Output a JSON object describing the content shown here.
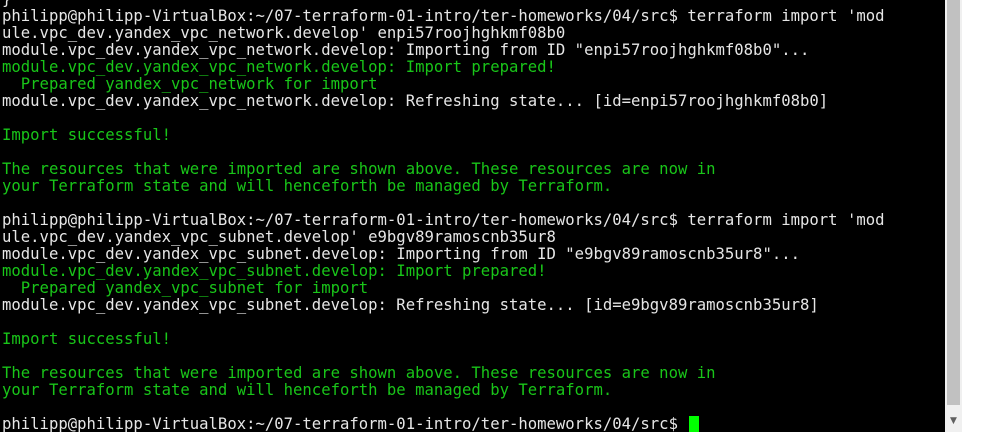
{
  "terminal": {
    "lines": [
      {
        "text": "}",
        "color": "white"
      },
      {
        "text": "philipp@philipp-VirtualBox:~/07-terraform-01-intro/ter-homeworks/04/src$ terraform import 'mod",
        "color": "white"
      },
      {
        "text": "ule.vpc_dev.yandex_vpc_network.develop' enpi57roojhghkmf08b0",
        "color": "white"
      },
      {
        "text": "module.vpc_dev.yandex_vpc_network.develop: Importing from ID \"enpi57roojhghkmf08b0\"...",
        "color": "white"
      },
      {
        "text": "module.vpc_dev.yandex_vpc_network.develop: Import prepared!",
        "color": "green"
      },
      {
        "text": "  Prepared yandex_vpc_network for import",
        "color": "green"
      },
      {
        "text": "module.vpc_dev.yandex_vpc_network.develop: Refreshing state... [id=enpi57roojhghkmf08b0]",
        "color": "white"
      },
      {
        "text": "",
        "color": "white"
      },
      {
        "text": "Import successful!",
        "color": "green"
      },
      {
        "text": "",
        "color": "white"
      },
      {
        "text": "The resources that were imported are shown above. These resources are now in",
        "color": "green"
      },
      {
        "text": "your Terraform state and will henceforth be managed by Terraform.",
        "color": "green"
      },
      {
        "text": "",
        "color": "white"
      },
      {
        "text": "philipp@philipp-VirtualBox:~/07-terraform-01-intro/ter-homeworks/04/src$ terraform import 'mod",
        "color": "white"
      },
      {
        "text": "ule.vpc_dev.yandex_vpc_subnet.develop' e9bgv89ramoscnb35ur8",
        "color": "white"
      },
      {
        "text": "module.vpc_dev.yandex_vpc_subnet.develop: Importing from ID \"e9bgv89ramoscnb35ur8\"...",
        "color": "white"
      },
      {
        "text": "module.vpc_dev.yandex_vpc_subnet.develop: Import prepared!",
        "color": "green"
      },
      {
        "text": "  Prepared yandex_vpc_subnet for import",
        "color": "green"
      },
      {
        "text": "module.vpc_dev.yandex_vpc_subnet.develop: Refreshing state... [id=e9bgv89ramoscnb35ur8]",
        "color": "white"
      },
      {
        "text": "",
        "color": "white"
      },
      {
        "text": "Import successful!",
        "color": "green"
      },
      {
        "text": "",
        "color": "white"
      },
      {
        "text": "The resources that were imported are shown above. These resources are now in",
        "color": "green"
      },
      {
        "text": "your Terraform state and will henceforth be managed by Terraform.",
        "color": "green"
      },
      {
        "text": "",
        "color": "white"
      }
    ],
    "prompt": "philipp@philipp-VirtualBox:~/07-terraform-01-intro/ter-homeworks/04/src$ "
  },
  "colors": {
    "background": "#000000",
    "text": "#e6e6e6",
    "success": "#19c519",
    "cursor": "#00ff00"
  },
  "icons": {
    "scroll_down": "scroll-down-arrow-icon"
  }
}
